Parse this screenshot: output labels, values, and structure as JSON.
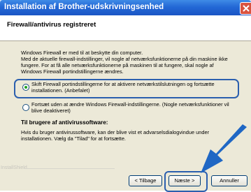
{
  "window": {
    "title": "Installation af Brother-udskrivningsenhed"
  },
  "header": {
    "title": "Firewall/antivirus registreret"
  },
  "body": {
    "line1": "Windows Firewall er med til at beskytte din computer.",
    "line2": "Med de aktuelle firewall-indstillinger, vil nogle af netværksfunktionerne på din maskine ikke",
    "line3": "fungere. For at få alle netværksfunktionerne på maskinen til at fungere, skal nogle af",
    "line4": "Windows Firewall portindstillingerne ændres."
  },
  "options": [
    {
      "line1": "Skift Firewall portindstillingerne for at aktivere netværkstilslutningen og fortsætte",
      "line2": "installationen. (Anbefalet)",
      "selected": true
    },
    {
      "line1": "Fortsæt uden at ændre Windows Firewall-indstillingerne. (Nogle netværksfunktioner vil",
      "line2": "blive deaktiveret)",
      "selected": false
    }
  ],
  "antivirus": {
    "title": "Til brugere af antivirussoftware:",
    "line1": "Hvis du bruger antivirussoftware, kan der blive vist et advarselsdialogvindue under",
    "line2": "installationen. Vælg da \"Tilad\" for at fortsætte."
  },
  "footer": {
    "brand": "InstallShield"
  },
  "buttons": {
    "back": "< Tilbage",
    "next": "Næste >",
    "cancel": "Annuller"
  },
  "colors": {
    "titlebar": "#2368d6",
    "highlight": "#2b5fae",
    "arrow": "#1f67c4",
    "panel": "#ece9d8"
  }
}
